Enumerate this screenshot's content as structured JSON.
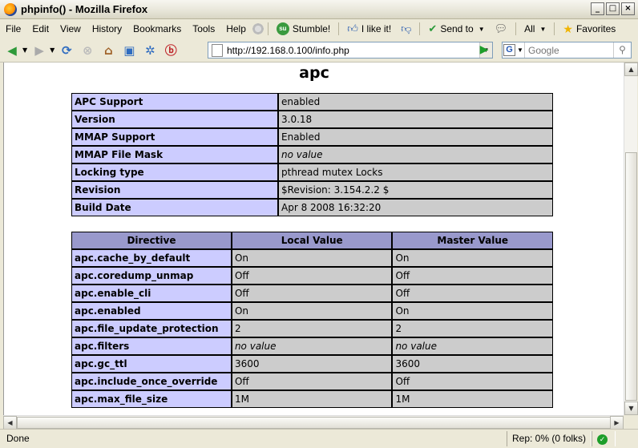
{
  "window": {
    "title": "phpinfo() - Mozilla Firefox",
    "buttons": {
      "minimize": "_",
      "maximize": "□",
      "close": "×"
    }
  },
  "menu": {
    "items": [
      "File",
      "Edit",
      "View",
      "History",
      "Bookmarks",
      "Tools",
      "Help"
    ],
    "stumble_label": "Stumble!",
    "like_label": "I like it!",
    "sendto_label": "Send to",
    "all_label": "All",
    "favorites_label": "Favorites"
  },
  "nav": {
    "url": "http://192.168.0.100/info.php",
    "search_placeholder": "Google"
  },
  "page": {
    "title": "apc",
    "info_rows": [
      {
        "label": "APC Support",
        "value": "enabled"
      },
      {
        "label": "Version",
        "value": "3.0.18"
      },
      {
        "label": "MMAP Support",
        "value": "Enabled"
      },
      {
        "label": "MMAP File Mask",
        "value": "no value"
      },
      {
        "label": "Locking type",
        "value": "pthread mutex Locks"
      },
      {
        "label": "Revision",
        "value": "$Revision: 3.154.2.2 $"
      },
      {
        "label": "Build Date",
        "value": "Apr 8 2008 16:32:20"
      }
    ],
    "directive_headers": [
      "Directive",
      "Local Value",
      "Master Value"
    ],
    "directives": [
      {
        "name": "apc.cache_by_default",
        "local": "On",
        "master": "On"
      },
      {
        "name": "apc.coredump_unmap",
        "local": "Off",
        "master": "Off"
      },
      {
        "name": "apc.enable_cli",
        "local": "Off",
        "master": "Off"
      },
      {
        "name": "apc.enabled",
        "local": "On",
        "master": "On"
      },
      {
        "name": "apc.file_update_protection",
        "local": "2",
        "master": "2"
      },
      {
        "name": "apc.filters",
        "local": "no value",
        "master": "no value"
      },
      {
        "name": "apc.gc_ttl",
        "local": "3600",
        "master": "3600"
      },
      {
        "name": "apc.include_once_override",
        "local": "Off",
        "master": "Off"
      },
      {
        "name": "apc.max_file_size",
        "local": "1M",
        "master": "1M"
      }
    ]
  },
  "status": {
    "text": "Done",
    "rep": "Rep: 0% (0 folks)"
  },
  "colors": {
    "label_cell": "#ccccff",
    "value_cell": "#cccccc",
    "header_cell": "#9999cc"
  }
}
